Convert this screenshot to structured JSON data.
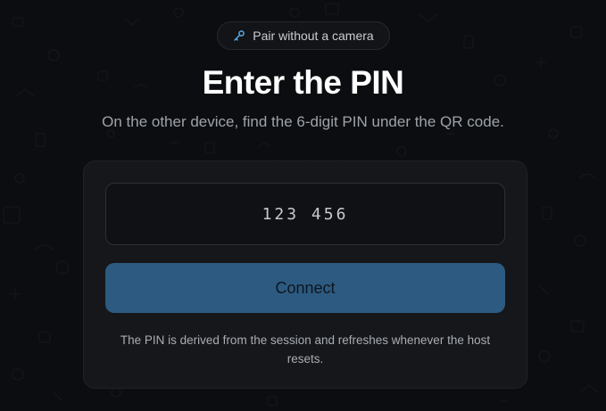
{
  "pill": {
    "label": "Pair without a camera",
    "icon": "key-icon"
  },
  "heading": {
    "title": "Enter the PIN",
    "subtitle": "On the other device, find the 6-digit PIN under the QR code."
  },
  "pin_form": {
    "value": "123 456",
    "connect_label": "Connect",
    "note": "The PIN is derived from the session and refreshes whenever the host resets."
  },
  "colors": {
    "background": "#0b0d10",
    "card": "#15171a",
    "accent": "#2d5a80",
    "icon_accent": "#5aa9e6"
  }
}
